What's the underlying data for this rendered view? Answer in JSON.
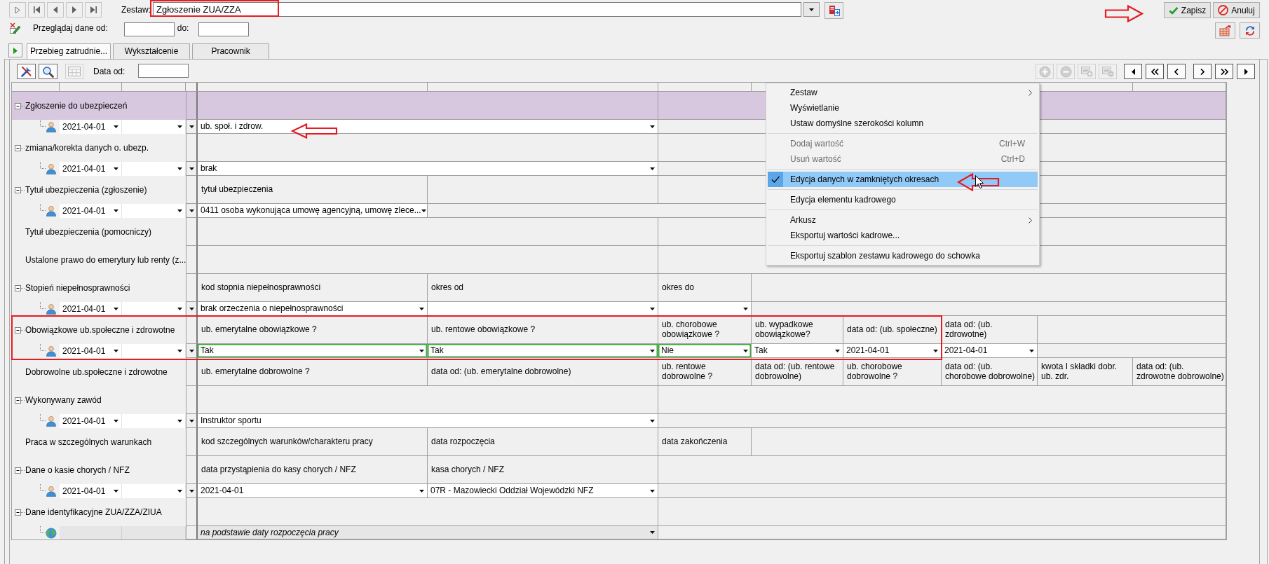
{
  "toolbar": {
    "set_label": "Zestaw:",
    "set_value": "Zgłoszenie ZUA/ZZA",
    "save_button": "Zapisz",
    "cancel_button": "Anuluj"
  },
  "range": {
    "from_label": "Przeglądaj dane od:",
    "to_label": "do:"
  },
  "tabs": [
    {
      "label": "Przebieg zatrudnie...",
      "selected": true
    },
    {
      "label": "Wykształcenie",
      "selected": false
    },
    {
      "label": "Pracownik",
      "selected": false
    }
  ],
  "grid_toolbar": {
    "date_label": "Data od:"
  },
  "groups": [
    {
      "label": "Zgłoszenie do ubezpieczeń",
      "expanded": true,
      "selected": true,
      "rows": [
        {
          "kind": "person",
          "disabled": false,
          "date": "2021-04-01",
          "values": [
            {
              "value": "ub. społ. i zdrow.",
              "changed": false
            }
          ]
        }
      ]
    },
    {
      "label": "zmiana/korekta danych o. ubezp.",
      "expanded": true,
      "selected": false,
      "rows": [
        {
          "kind": "person",
          "disabled": false,
          "date": "2021-04-01",
          "values": [
            {
              "value": "brak",
              "changed": false
            }
          ]
        }
      ]
    },
    {
      "label": "Tytuł ubezpieczenia (zgłoszenie)",
      "expanded": true,
      "selected": false,
      "headers": [
        "tytuł ubezpieczenia"
      ],
      "rows": [
        {
          "kind": "person",
          "disabled": false,
          "date": "2021-04-01",
          "values": [
            {
              "value": "0411 osoba wykonująca umowę agencyjną, umowę zlece...",
              "changed": false
            }
          ]
        }
      ]
    },
    {
      "label": "Tytuł ubezpieczenia (pomocniczy)",
      "selected": false
    },
    {
      "label": "Ustalone prawo do emerytury lub renty (z...",
      "selected": false
    },
    {
      "label": "Stopień niepełnosprawności",
      "expanded": true,
      "selected": false,
      "headers": [
        "kod stopnia niepełnosprawności",
        "okres od",
        "okres do"
      ],
      "rows": [
        {
          "kind": "person",
          "disabled": false,
          "date": "2021-04-01",
          "values": [
            {
              "value": "brak orzeczenia o niepełnosprawności",
              "changed": false
            },
            {
              "changed": false
            },
            {
              "changed": false
            }
          ]
        }
      ]
    },
    {
      "label": "Obowiązkowe ub.społeczne i zdrowotne",
      "expanded": true,
      "selected": false,
      "headers": [
        "ub. emerytalne obowiązkowe ?",
        "ub. rentowe obowiązkowe ?",
        "ub. chorobowe obowiązkowe ?",
        "ub. wypadkowe obowiązkowe?",
        "data od: (ub. społeczne)",
        "data od: (ub. zdrowotne)"
      ],
      "rows": [
        {
          "kind": "person",
          "disabled": false,
          "date": "2021-04-01",
          "values": [
            {
              "value": "Tak",
              "changed": true
            },
            {
              "value": "Tak",
              "changed": true
            },
            {
              "value": "Nie",
              "changed": true
            },
            {
              "value": "Tak",
              "changed": false
            },
            {
              "value": "2021-04-01",
              "changed": false
            },
            {
              "value": "2021-04-01",
              "changed": false
            }
          ]
        }
      ]
    },
    {
      "label": "Dobrowolne ub.społeczne i zdrowotne",
      "selected": false,
      "headers": [
        "ub. emerytalne dobrowolne ?",
        "data od: (ub. emerytalne dobrowolne)",
        "ub. rentowe dobrowolne ?",
        "data od: (ub. rentowe dobrowolne)",
        "ub. chorobowe dobrowolne ?",
        "data od: (ub. chorobowe dobrowolne)",
        "kwota I składki dobr. ub. zdr.",
        "data od: (ub. zdrowotne dobrowolne)"
      ]
    },
    {
      "label": "Wykonywany zawód",
      "expanded": true,
      "selected": false,
      "rows": [
        {
          "kind": "person",
          "disabled": false,
          "date": "2021-04-01",
          "values": [
            {
              "value": "Instruktor sportu",
              "changed": false
            }
          ]
        }
      ]
    },
    {
      "label": "Praca w szczególnych warunkach",
      "selected": false,
      "headers": [
        "kod szczególnych warunków/charakteru pracy",
        "data rozpoczęcia",
        "data zakończenia"
      ]
    },
    {
      "label": "Dane o kasie chorych / NFZ",
      "expanded": true,
      "selected": false,
      "headers": [
        "data przystąpienia do kasy chorych / NFZ",
        "kasa chorych / NFZ"
      ],
      "rows": [
        {
          "kind": "person",
          "disabled": false,
          "date": "2021-04-01",
          "values": [
            {
              "value": "2021-04-01",
              "changed": false
            },
            {
              "value": "07R - Mazowiecki Oddział Wojewódzki NFZ",
              "changed": false
            }
          ]
        }
      ]
    },
    {
      "label": "Dane identyfikacyjne ZUA/ZZA/ZIUA",
      "expanded": true,
      "selected": false,
      "rows": [
        {
          "kind": "globe",
          "disabled": true,
          "values": [
            {
              "value": "na podstawie daty rozpoczęcia pracy",
              "changed": false
            }
          ]
        }
      ]
    }
  ],
  "context_menu": [
    {
      "kind": "item",
      "label": "Zestaw",
      "submenu": true,
      "disabled": false,
      "checked": false,
      "selected": false
    },
    {
      "kind": "item",
      "label": "Wyświetlanie",
      "submenu": false,
      "disabled": false,
      "checked": false,
      "selected": false
    },
    {
      "kind": "item",
      "label": "Ustaw domyślne szerokości kolumn",
      "submenu": false,
      "disabled": false,
      "checked": false,
      "selected": false
    },
    {
      "kind": "separator"
    },
    {
      "kind": "item",
      "label": "Dodaj wartość",
      "shortcut": "Ctrl+W",
      "submenu": false,
      "disabled": true,
      "checked": false,
      "selected": false
    },
    {
      "kind": "item",
      "label": "Usuń wartość",
      "shortcut": "Ctrl+D",
      "submenu": false,
      "disabled": true,
      "checked": false,
      "selected": false
    },
    {
      "kind": "separator"
    },
    {
      "kind": "item",
      "label": "Edycja danych w zamkniętych okresach",
      "submenu": false,
      "disabled": false,
      "checked": true,
      "selected": true
    },
    {
      "kind": "separator"
    },
    {
      "kind": "item",
      "label": "Edycja elementu kadrowego",
      "submenu": false,
      "disabled": false,
      "checked": false,
      "selected": false
    },
    {
      "kind": "separator"
    },
    {
      "kind": "item",
      "label": "Arkusz",
      "submenu": true,
      "disabled": false,
      "checked": false,
      "selected": false
    },
    {
      "kind": "item",
      "label": "Eksportuj wartości kadrowe...",
      "submenu": false,
      "disabled": false,
      "checked": false,
      "selected": false
    },
    {
      "kind": "separator"
    },
    {
      "kind": "item",
      "label": "Eksportuj szablon zestawu kadrowego do schowka",
      "submenu": false,
      "disabled": false,
      "checked": false,
      "selected": false
    }
  ]
}
